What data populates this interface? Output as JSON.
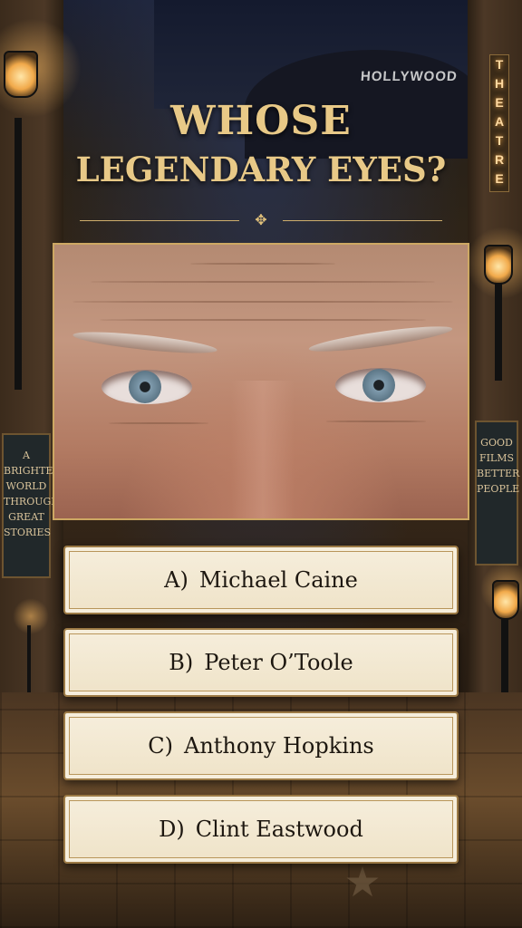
{
  "background": {
    "sign_text": "HOLLYWOOD",
    "theatre_text": "THEATRE",
    "poster_left": [
      "A",
      "BRIGHTER",
      "WORLD",
      "THROUGH",
      "GREAT",
      "STORIES"
    ],
    "poster_right": [
      "GOOD",
      "FILMS",
      "BETTER",
      "PEOPLE"
    ]
  },
  "quiz": {
    "title_line1": "WHOSE",
    "title_line2": "LEGENDARY EYES?",
    "ornament": "✥",
    "options": [
      {
        "letter": "A)",
        "text": "Michael Caine"
      },
      {
        "letter": "B)",
        "text": "Peter O’Toole"
      },
      {
        "letter": "C)",
        "text": "Anthony Hopkins"
      },
      {
        "letter": "D)",
        "text": "Clint Eastwood"
      }
    ]
  },
  "colors": {
    "title_gold": "#e8c987",
    "card_bg": "#f3e9d2",
    "card_border": "#9c7a45"
  }
}
